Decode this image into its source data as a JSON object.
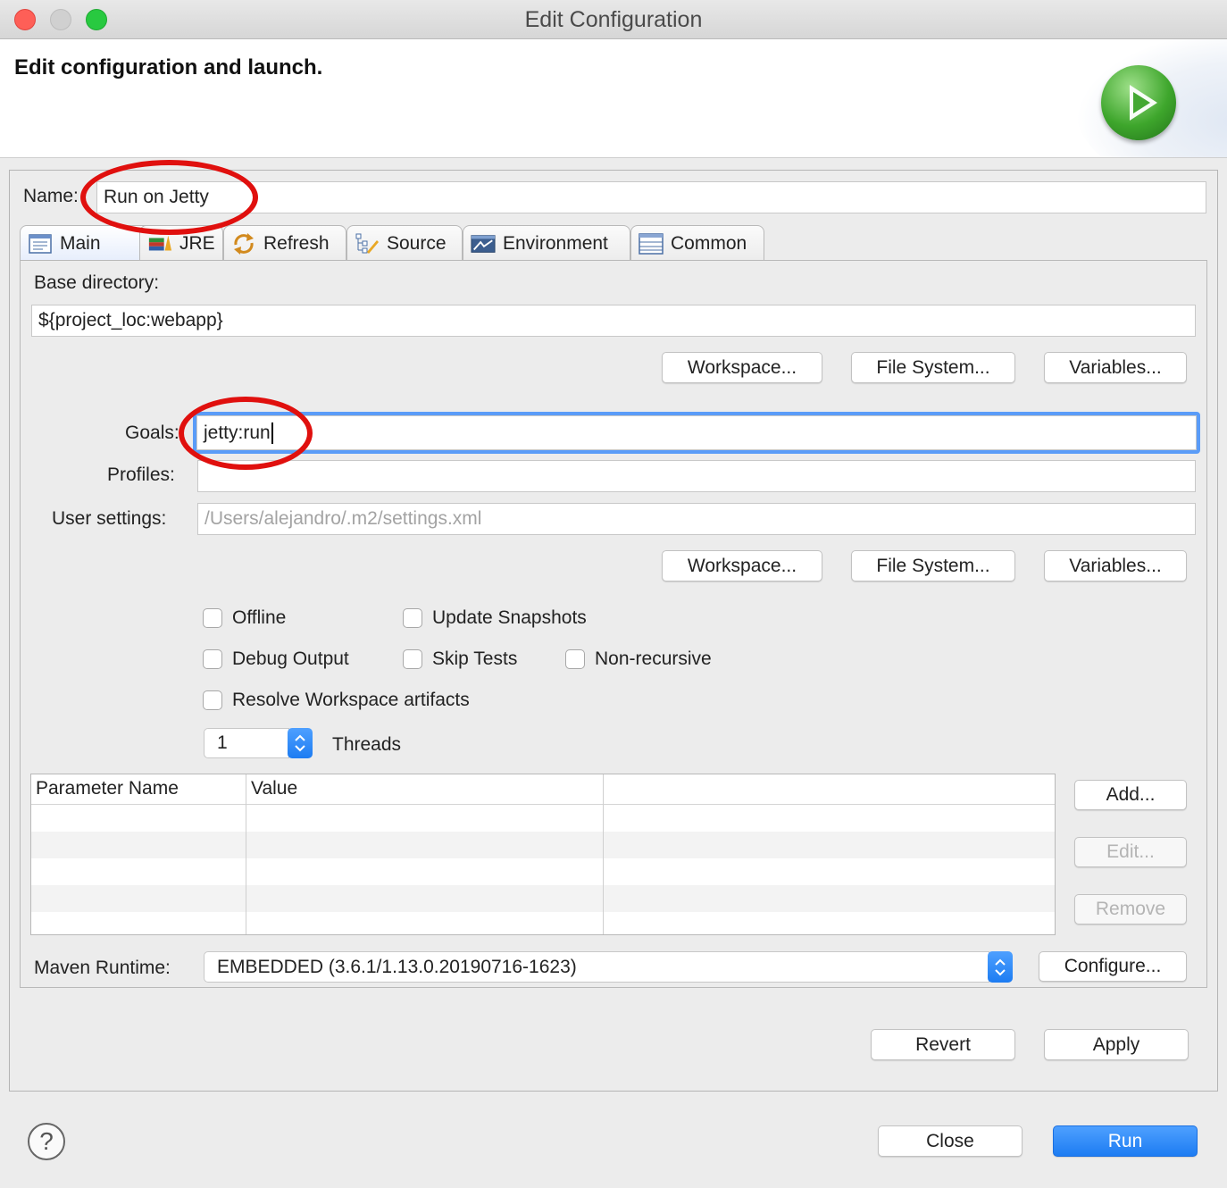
{
  "window": {
    "title": "Edit Configuration"
  },
  "header": {
    "title": "Edit configuration and launch."
  },
  "name_field": {
    "label": "Name:",
    "value": "Run on Jetty"
  },
  "tabs": [
    {
      "label": "Main",
      "icon": "main-tab-icon",
      "active": true
    },
    {
      "label": "JRE",
      "icon": "jre-books-icon"
    },
    {
      "label": "Refresh",
      "icon": "refresh-arrows-icon"
    },
    {
      "label": "Source",
      "icon": "source-tree-pencil-icon"
    },
    {
      "label": "Environment",
      "icon": "environment-window-icon"
    },
    {
      "label": "Common",
      "icon": "common-table-icon"
    }
  ],
  "main": {
    "base_directory_label": "Base directory:",
    "base_directory_value": "${project_loc:webapp}",
    "dir_buttons": [
      "Workspace...",
      "File System...",
      "Variables..."
    ],
    "goals_label": "Goals:",
    "goals_value": "jetty:run",
    "profiles_label": "Profiles:",
    "profiles_value": "",
    "user_settings_label": "User settings:",
    "user_settings_placeholder": "/Users/alejandro/.m2/settings.xml",
    "settings_buttons": [
      "Workspace...",
      "File System...",
      "Variables..."
    ],
    "checkboxes": {
      "offline": "Offline",
      "update_snapshots": "Update Snapshots",
      "debug_output": "Debug Output",
      "skip_tests": "Skip Tests",
      "non_recursive": "Non-recursive",
      "resolve_workspace": "Resolve Workspace artifacts"
    },
    "threads_value": "1",
    "threads_label": "Threads",
    "param_table": {
      "columns": [
        "Parameter Name",
        "Value"
      ],
      "rows": []
    },
    "param_buttons": {
      "add": "Add...",
      "edit": "Edit...",
      "remove": "Remove"
    },
    "runtime_label": "Maven Runtime:",
    "runtime_value": "EMBEDDED (3.6.1/1.13.0.20190716-1623)",
    "configure_label": "Configure..."
  },
  "actions": {
    "revert": "Revert",
    "apply": "Apply",
    "close": "Close",
    "run": "Run"
  },
  "colors": {
    "accent": "#1d7cf2",
    "annotation": "#e0100e",
    "focus_ring": "#5a9cf8"
  }
}
